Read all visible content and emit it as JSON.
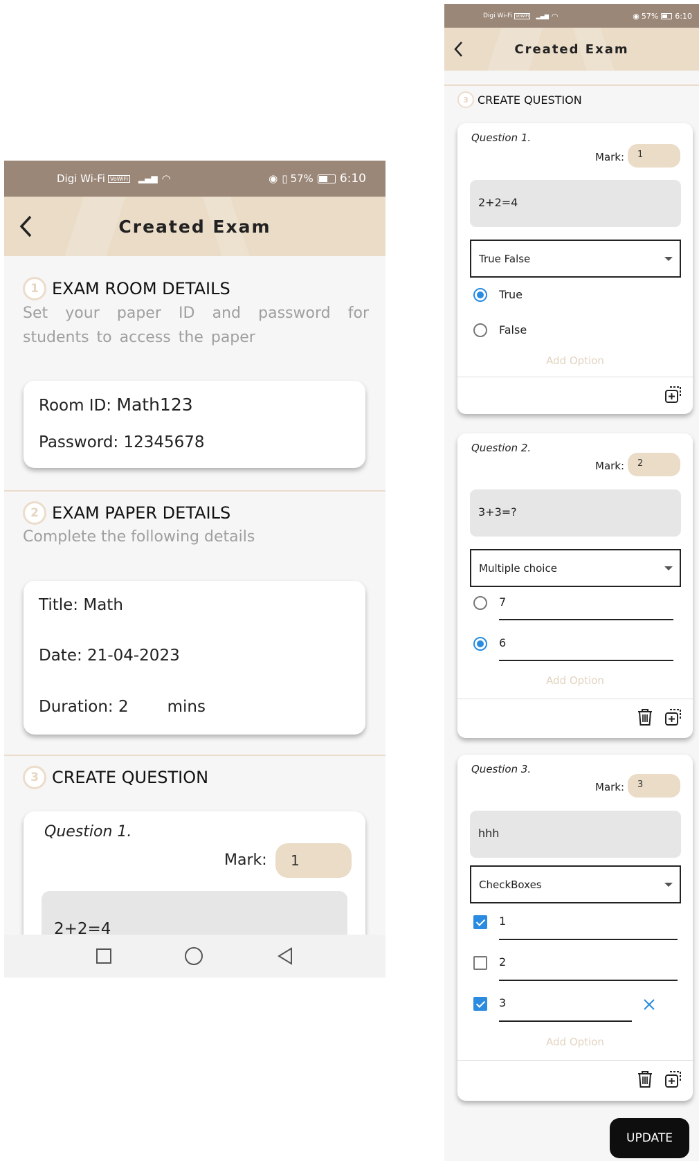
{
  "status": {
    "carrier": "Digi Wi-Fi",
    "vowifi": "VoWiFi",
    "battery": "57%",
    "time": "6:10"
  },
  "appbar": {
    "title": "Created Exam"
  },
  "section1": {
    "num": "1",
    "title": "EXAM ROOM DETAILS",
    "desc": "Set your paper ID and password for students to access the paper"
  },
  "room": {
    "id_label": "Room ID:",
    "id": "Math123",
    "pw_label": "Password:",
    "pw": "12345678"
  },
  "section2": {
    "num": "2",
    "title": "EXAM PAPER DETAILS",
    "desc": "Complete the following details"
  },
  "paper": {
    "title_label": "Title:",
    "title": "Math",
    "date_label": "Date:",
    "date": "21-04-2023",
    "duration_label": "Duration:",
    "duration": "2",
    "duration_unit": "mins"
  },
  "section3": {
    "num": "3",
    "title": "CREATE QUESTION"
  },
  "mark_label": "Mark:",
  "add_option": "Add Option",
  "questions": [
    {
      "label": "Question 1.",
      "mark": "1",
      "text": "2+2=4",
      "type": "True False",
      "options": [
        "True",
        "False"
      ],
      "selected": [
        true,
        false
      ]
    },
    {
      "label": "Question 2.",
      "mark": "2",
      "text": "3+3=?",
      "type": "Multiple choice",
      "options": [
        "7",
        "6"
      ],
      "selected": [
        false,
        true
      ]
    },
    {
      "label": "Question 3.",
      "mark": "3",
      "text": "hhh",
      "type": "CheckBoxes",
      "options": [
        "1",
        "2",
        "3"
      ],
      "selected": [
        true,
        false,
        true
      ]
    }
  ],
  "update_button": "UPDATE",
  "icons": {
    "back": "chevron-left-icon",
    "delete": "trash-icon",
    "duplicate": "copy-add-icon",
    "remove": "close-icon",
    "nav_recent": "square-icon",
    "nav_home": "circle-icon",
    "nav_back": "triangle-back-icon"
  },
  "colors": {
    "accent": "#2a8be0",
    "beige": "#eadcc7",
    "statusbar": "#9b8778"
  }
}
